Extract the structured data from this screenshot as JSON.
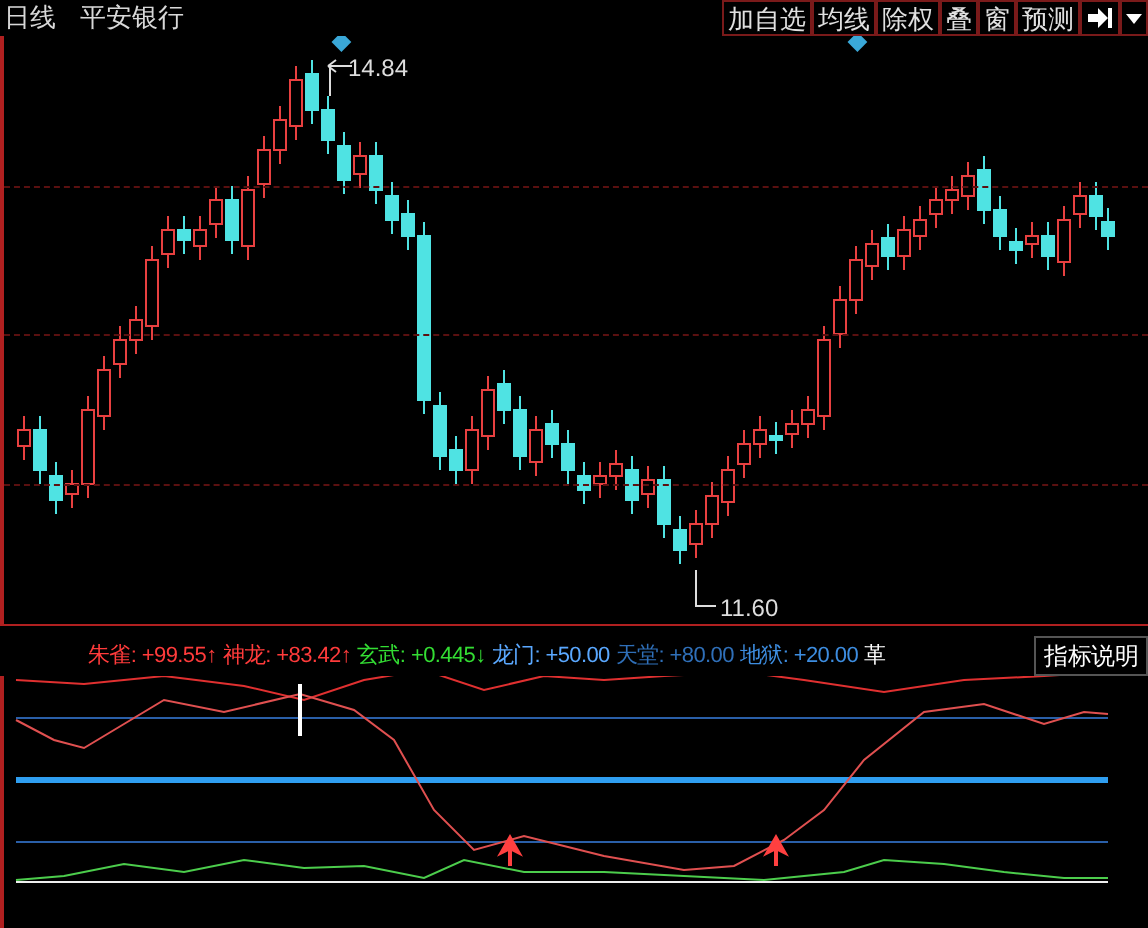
{
  "header": {
    "period": "日线",
    "stock": "平安银行"
  },
  "toolbar": [
    {
      "label": "加自选"
    },
    {
      "label": "均线"
    },
    {
      "label": "除权"
    },
    {
      "label": "叠"
    },
    {
      "label": "窗"
    },
    {
      "label": "预测"
    }
  ],
  "price_labels": {
    "high": "14.84",
    "low": "11.60"
  },
  "indicator": {
    "readings": [
      {
        "name": "朱雀:",
        "value": "+99.55↑",
        "color": "#ff3b3b"
      },
      {
        "name": "神龙:",
        "value": "+83.42↑",
        "color": "#ff3b3b"
      },
      {
        "name": "玄武:",
        "value": "+0.445↓",
        "color": "#33dd33"
      },
      {
        "name": "龙门:",
        "value": "+50.00",
        "color": "#5aa8ff"
      },
      {
        "name": "天堂:",
        "value": "+80.00",
        "color": "#2f6fb8"
      },
      {
        "name": "地狱:",
        "value": "+20.00",
        "color": "#3d8de0"
      }
    ],
    "cut_label": "革",
    "help_button": "指标说明"
  }
}
